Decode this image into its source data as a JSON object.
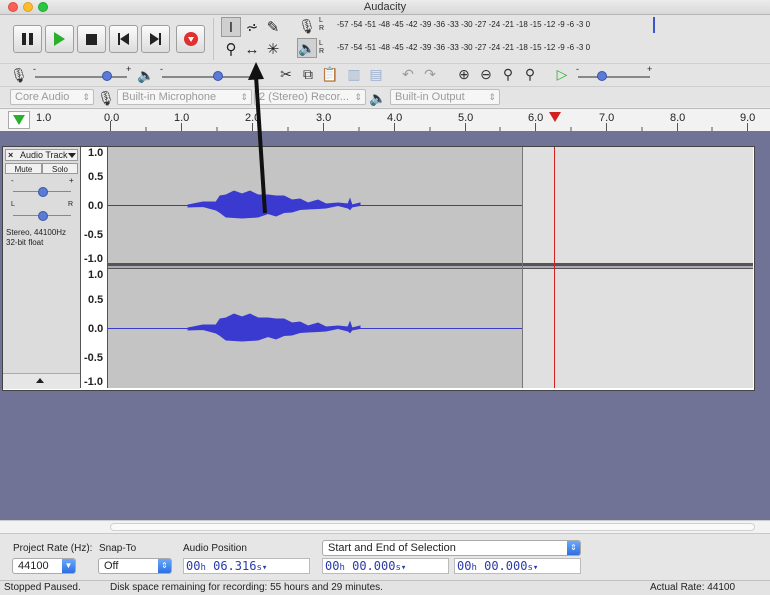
{
  "window": {
    "title": "Audacity"
  },
  "meters": {
    "record_scale": "-57 -54 -51 -48 -45 -42 -39 -36 -33 -30 -27 -24 -21 -18 -15 -12 -9 -6 -3 0",
    "play_scale": "-57 -54 -51 -48 -45 -42 -39 -36 -33 -30 -27 -24 -21 -18 -15 -12 -9 -6 -3 0",
    "left_channel": "L",
    "right_channel": "R"
  },
  "mixer": {
    "minus": "-",
    "plus": "+"
  },
  "devices": {
    "host": "Core Audio",
    "input": "Built-in Microphone",
    "channels": "2 (Stereo) Recor...",
    "output": "Built-in Output"
  },
  "ruler": {
    "labels": [
      "1.0",
      "0.0",
      "1.0",
      "2.0",
      "3.0",
      "4.0",
      "5.0",
      "6.0",
      "7.0",
      "8.0",
      "9.0"
    ]
  },
  "track": {
    "name": "Audio Track",
    "mute": "Mute",
    "solo": "Solo",
    "gain_minus": "-",
    "gain_plus": "+",
    "pan_left": "L",
    "pan_right": "R",
    "info_line1": "Stereo, 44100Hz",
    "info_line2": "32-bit float",
    "scale": [
      "1.0",
      "0.5",
      "0.0",
      "-0.5",
      "-1.0"
    ]
  },
  "selection_bar": {
    "rate_label": "Project Rate (Hz):",
    "rate_value": "44100",
    "snap_label": "Snap-To",
    "snap_value": "Off",
    "position_label": "Audio Position",
    "position_value": {
      "h": "00",
      "m": "06.316"
    },
    "selection_mode": "Start and End of Selection",
    "start_value": {
      "h": "00",
      "m": "00.000"
    },
    "end_value": {
      "h": "00",
      "m": "00.000"
    },
    "units": {
      "h": "h",
      "m": "m",
      "s": "s"
    }
  },
  "status": {
    "state": "Stopped Paused.",
    "disk": "Disk space remaining for recording: 55 hours and 29 minutes.",
    "rate": "Actual Rate: 44100"
  },
  "colors": {
    "waveform": "#3a3ad0",
    "playhead": "#d02020",
    "background": "#707396"
  },
  "icons": [
    "pause-icon",
    "play-icon",
    "stop-icon",
    "skip-start-icon",
    "skip-end-icon",
    "record-icon",
    "select-tool-icon",
    "envelope-tool-icon",
    "draw-tool-icon",
    "zoom-tool-icon",
    "timeshift-tool-icon",
    "multi-tool-icon",
    "microphone-icon",
    "speaker-icon",
    "cut-icon",
    "copy-icon",
    "paste-icon",
    "trim-icon",
    "silence-icon",
    "undo-icon",
    "redo-icon",
    "zoom-in-icon",
    "zoom-out-icon",
    "fit-selection-icon",
    "fit-project-icon",
    "play-at-speed-icon"
  ]
}
